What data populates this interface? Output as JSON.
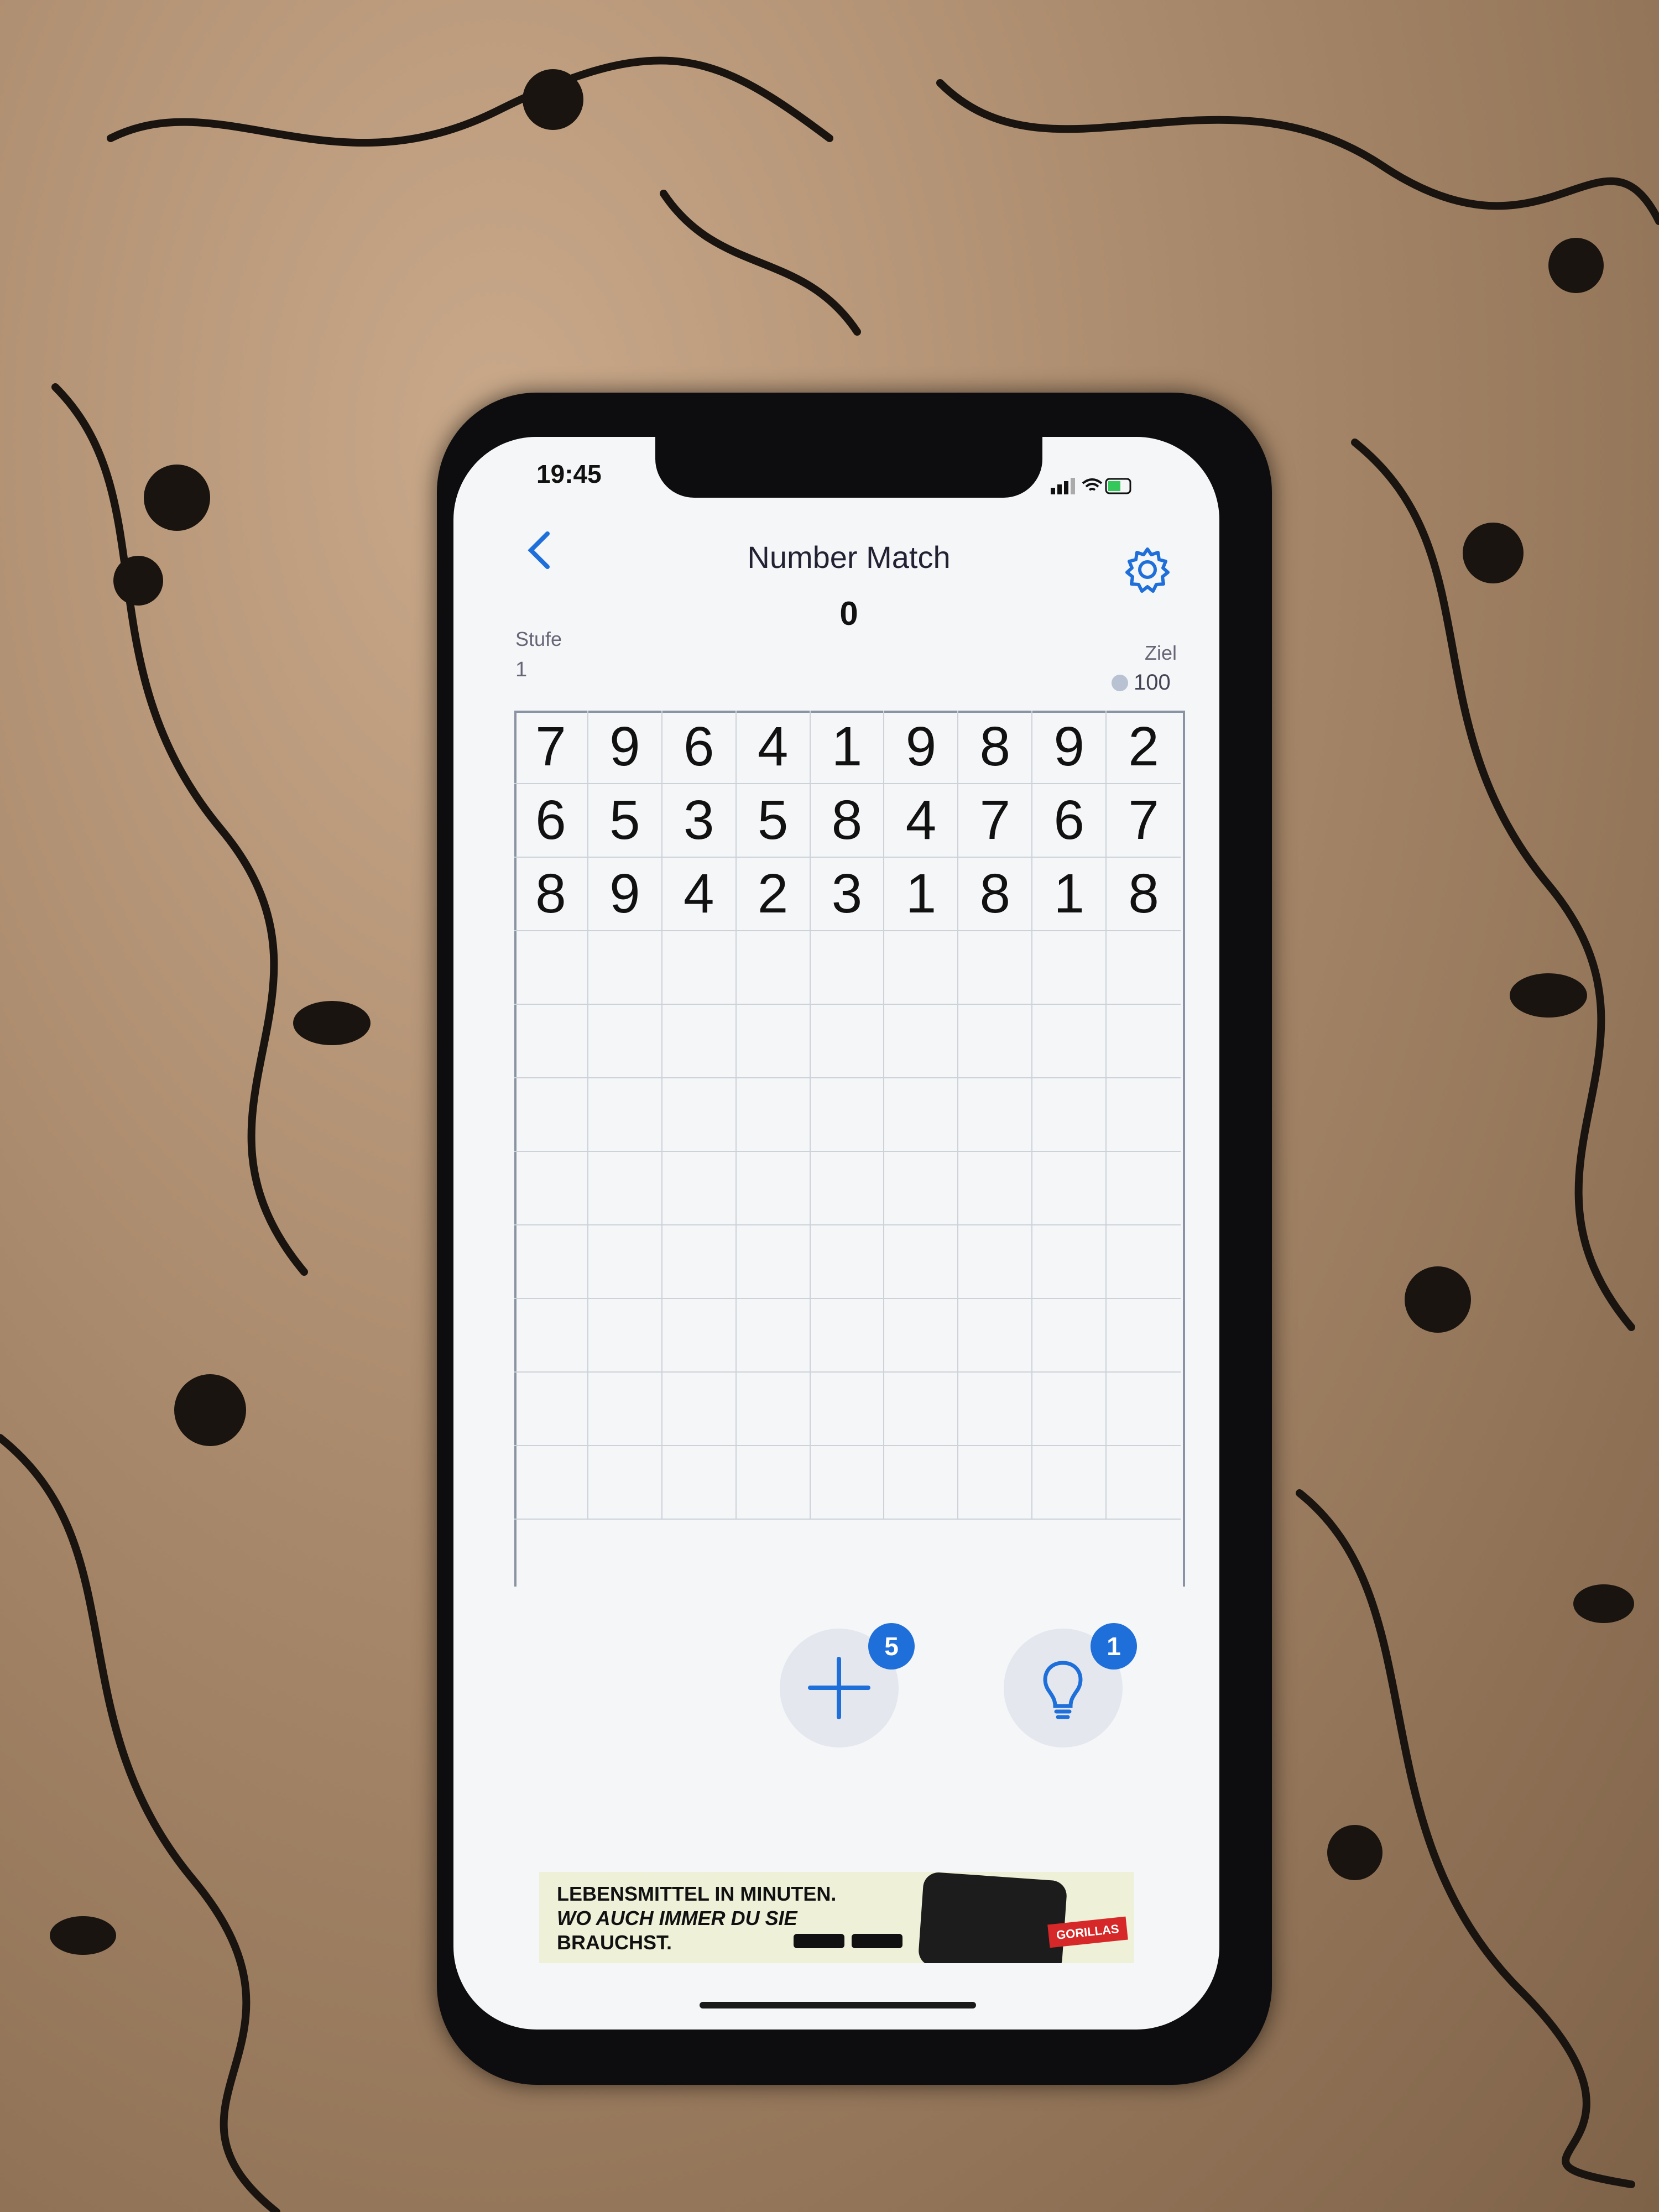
{
  "status_bar": {
    "time": "19:45"
  },
  "header": {
    "title": "Number Match",
    "score": "0"
  },
  "level": {
    "label": "Stufe",
    "value": "1"
  },
  "goal": {
    "label": "Ziel",
    "value": "100"
  },
  "grid": {
    "columns": 9,
    "rows": [
      [
        "7",
        "9",
        "6",
        "4",
        "1",
        "9",
        "8",
        "9",
        "2"
      ],
      [
        "6",
        "5",
        "3",
        "5",
        "8",
        "4",
        "7",
        "6",
        "7"
      ],
      [
        "8",
        "9",
        "4",
        "2",
        "3",
        "1",
        "8",
        "1",
        "8"
      ],
      [
        "",
        "",
        "",
        "",
        "",
        "",
        "",
        "",
        ""
      ],
      [
        "",
        "",
        "",
        "",
        "",
        "",
        "",
        "",
        ""
      ],
      [
        "",
        "",
        "",
        "",
        "",
        "",
        "",
        "",
        ""
      ],
      [
        "",
        "",
        "",
        "",
        "",
        "",
        "",
        "",
        ""
      ],
      [
        "",
        "",
        "",
        "",
        "",
        "",
        "",
        "",
        ""
      ],
      [
        "",
        "",
        "",
        "",
        "",
        "",
        "",
        "",
        ""
      ],
      [
        "",
        "",
        "",
        "",
        "",
        "",
        "",
        "",
        ""
      ],
      [
        "",
        "",
        "",
        "",
        "",
        "",
        "",
        "",
        ""
      ]
    ]
  },
  "actions": {
    "add_numbers": {
      "icon": "plus-icon",
      "count": "5"
    },
    "hint": {
      "icon": "lightbulb-icon",
      "count": "1"
    }
  },
  "ad": {
    "line1": "LEBENSMITTEL IN MINUTEN.",
    "line2": "WO AUCH IMMER DU SIE",
    "line3": "BRAUCHST.",
    "brand": "GORILLAS"
  },
  "colors": {
    "accent": "#1e6fd9",
    "background": "#f4f6f8"
  }
}
